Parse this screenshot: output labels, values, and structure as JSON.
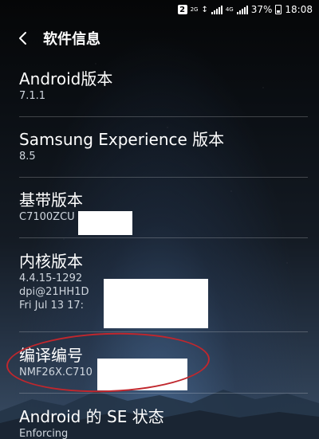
{
  "status_bar": {
    "sim_slot": "2",
    "network_tag_1": "2G",
    "network_tag_2": "4G",
    "battery_percent": "37%",
    "time": "18:08"
  },
  "header": {
    "back_icon": "chevron-left-icon",
    "title": "软件信息"
  },
  "items": [
    {
      "title": "Android版本",
      "values": [
        "7.1.1"
      ]
    },
    {
      "title": "Samsung Experience 版本",
      "values": [
        "8.5"
      ]
    },
    {
      "title": "基带版本",
      "values": [
        "C7100ZCU"
      ]
    },
    {
      "title": "内核版本",
      "values": [
        "4.4.15-1292",
        "dpi@21HH1D",
        "Fri Jul 13 17:"
      ]
    },
    {
      "title": "编译编号",
      "values": [
        "NMF26X.C710"
      ]
    },
    {
      "title": "Android 的 SE 状态",
      "values": [
        "Enforcing"
      ]
    }
  ],
  "colors": {
    "annotation_circle": "#c0272d",
    "redaction": "#ffffff"
  }
}
